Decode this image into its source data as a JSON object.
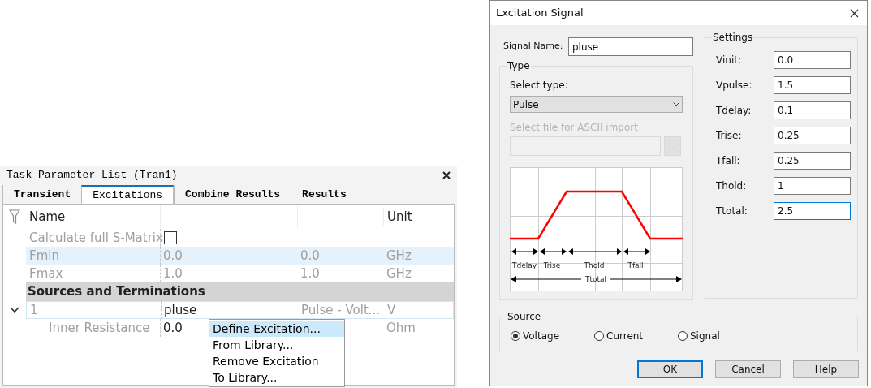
{
  "task_panel": {
    "title": "Task Parameter List (Tran1)",
    "tabs": [
      {
        "label": "Transient",
        "selected": false
      },
      {
        "label": "Excitations",
        "selected": true
      },
      {
        "label": "Combine Results",
        "selected": false
      },
      {
        "label": "Results",
        "selected": false
      }
    ],
    "header": {
      "name": "Name",
      "unit": "Unit"
    },
    "rows": [
      {
        "kind": "checkbox",
        "name": "Calculate full S-Matrix",
        "checked": false
      },
      {
        "kind": "param",
        "name": "Fmin",
        "value": "0.0",
        "value_2": "0.0",
        "unit": "GHz",
        "selected": true
      },
      {
        "kind": "param",
        "name": "Fmax",
        "value": "1.0",
        "value_2": "1.0",
        "unit": "GHz",
        "selected": false
      },
      {
        "kind": "section",
        "name": "Sources and Terminations"
      },
      {
        "kind": "port",
        "name": "1",
        "value": "pluse",
        "value_2": "Pulse - Volt...",
        "unit": "V",
        "expanded": true,
        "children": [
          {
            "name": "Inner Resistance",
            "value": "0.0",
            "unit": "Ohm"
          }
        ]
      }
    ],
    "context_menu": [
      {
        "label": "Define Excitation...",
        "selected": true
      },
      {
        "label": "From Library...",
        "selected": false
      },
      {
        "label": "Remove Excitation",
        "selected": false
      },
      {
        "label": "To Library...",
        "selected": false
      }
    ]
  },
  "dialog": {
    "title": "Lxcitation Signal",
    "signal_name": {
      "label": "Signal Name:",
      "value": "pluse"
    },
    "type_group": {
      "title": "Type",
      "select_label": "Select type:",
      "select_value": "Pulse",
      "file_label": "Select file for ASCII import",
      "file_disabled": true,
      "browse": "...",
      "diagram_labels": [
        "Tdelay",
        "Trise",
        "Thold",
        "Tfall"
      ],
      "total_label": "Ttotal"
    },
    "settings": {
      "title": "Settings",
      "fields": [
        {
          "label": "Vinit:",
          "value": "0.0",
          "focused": false
        },
        {
          "label": "Vpulse:",
          "value": "1.5",
          "focused": false
        },
        {
          "label": "Tdelay:",
          "value": "0.1",
          "focused": false
        },
        {
          "label": "Trise:",
          "value": "0.25",
          "focused": false
        },
        {
          "label": "Tfall:",
          "value": "0.25",
          "focused": false
        },
        {
          "label": "Thold:",
          "value": "1",
          "focused": false
        },
        {
          "label": "Ttotal:",
          "value": "2.5",
          "focused": true
        }
      ]
    },
    "source": {
      "title": "Source",
      "options": [
        {
          "label": "Voltage",
          "selected": true
        },
        {
          "label": "Current",
          "selected": false
        },
        {
          "label": "Signal",
          "selected": false
        }
      ]
    },
    "buttons": [
      {
        "label": "OK",
        "default": true
      },
      {
        "label": "Cancel",
        "default": false
      },
      {
        "label": "Help",
        "default": false
      }
    ]
  }
}
